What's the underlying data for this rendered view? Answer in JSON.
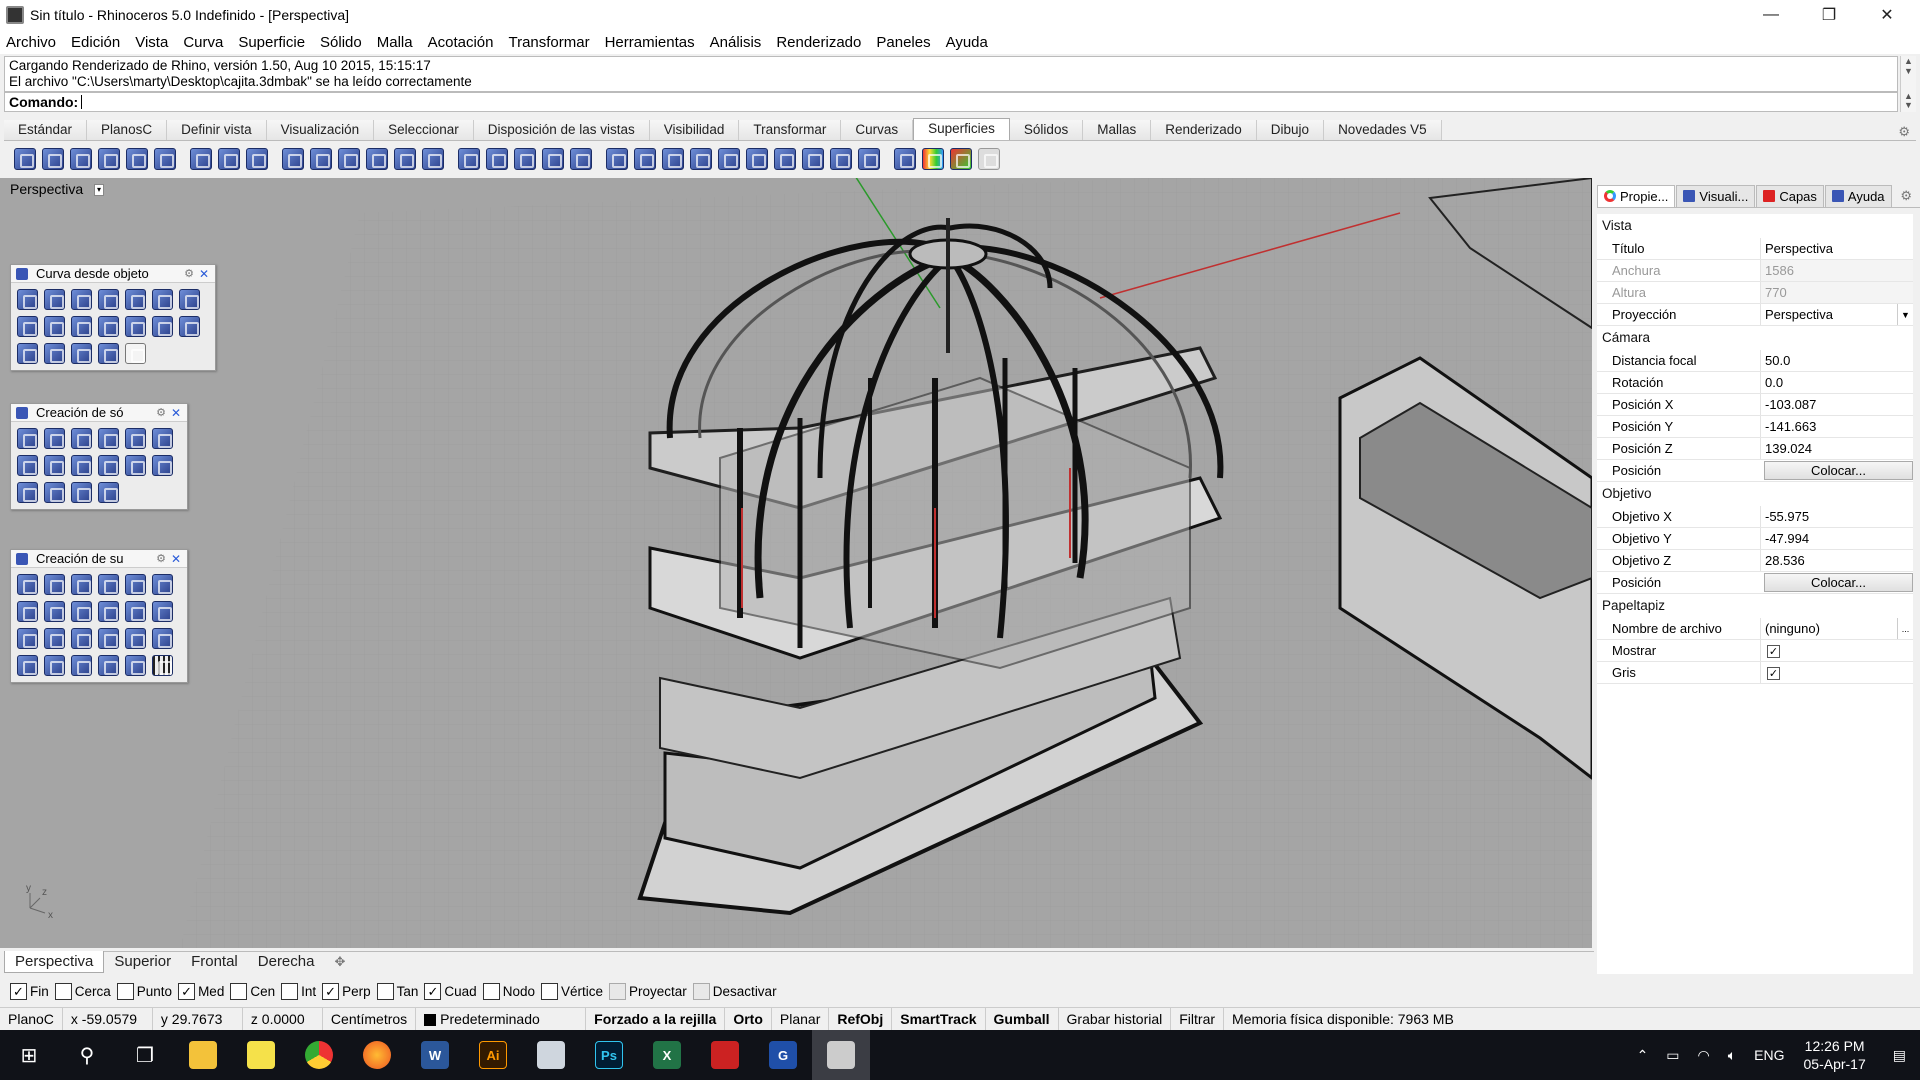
{
  "window": {
    "title": "Sin título - Rhinoceros 5.0 Indefinido - [Perspectiva]",
    "minimize": "—",
    "restore": "❐",
    "close": "✕"
  },
  "menu": [
    "Archivo",
    "Edición",
    "Vista",
    "Curva",
    "Superficie",
    "Sólido",
    "Malla",
    "Acotación",
    "Transformar",
    "Herramientas",
    "Análisis",
    "Renderizado",
    "Paneles",
    "Ayuda"
  ],
  "command_history": {
    "line1": "Cargando Renderizado de Rhino, versión 1.50, Aug 10 2015, 15:15:17",
    "line2": "El archivo \"C:\\Users\\marty\\Desktop\\cajita.3dmbak\" se ha leído correctamente"
  },
  "command_prompt": "Comando:",
  "toolbar_tabs": [
    "Estándar",
    "PlanosC",
    "Definir vista",
    "Visualización",
    "Seleccionar",
    "Disposición de las vistas",
    "Visibilidad",
    "Transformar",
    "Curvas",
    "Superficies",
    "Sólidos",
    "Mallas",
    "Renderizado",
    "Dibujo",
    "Novedades V5"
  ],
  "toolbar_active_tab": "Superficies",
  "viewport": {
    "label": "Perspectiva",
    "axis_label_x": "x",
    "axis_label_y": "y",
    "axis_label_z": "z"
  },
  "palettes": [
    {
      "title": "Curva desde objeto"
    },
    {
      "title": "Creación de só"
    },
    {
      "title": "Creación de su"
    }
  ],
  "panel_tabs": [
    "Propie...",
    "Visuali...",
    "Capas",
    "Ayuda"
  ],
  "properties": {
    "vista_header": "Vista",
    "titulo": {
      "label": "Título",
      "value": "Perspectiva"
    },
    "anchura": {
      "label": "Anchura",
      "value": "1586"
    },
    "altura": {
      "label": "Altura",
      "value": "770"
    },
    "proyeccion": {
      "label": "Proyección",
      "value": "Perspectiva"
    },
    "camara_header": "Cámara",
    "distancia_focal": {
      "label": "Distancia focal",
      "value": "50.0"
    },
    "rotacion": {
      "label": "Rotación",
      "value": "0.0"
    },
    "pos_x": {
      "label": "Posición X",
      "value": "-103.087"
    },
    "pos_y": {
      "label": "Posición Y",
      "value": "-141.663"
    },
    "pos_z": {
      "label": "Posición Z",
      "value": "139.024"
    },
    "posicion_cam": {
      "label": "Posición",
      "button": "Colocar..."
    },
    "objetivo_header": "Objetivo",
    "obj_x": {
      "label": "Objetivo X",
      "value": "-55.975"
    },
    "obj_y": {
      "label": "Objetivo Y",
      "value": "-47.994"
    },
    "obj_z": {
      "label": "Objetivo Z",
      "value": "28.536"
    },
    "posicion_obj": {
      "label": "Posición",
      "button": "Colocar..."
    },
    "papeltapiz_header": "Papeltapiz",
    "nombre_archivo": {
      "label": "Nombre de archivo",
      "value": "(ninguno)",
      "button": "..."
    },
    "mostrar": {
      "label": "Mostrar",
      "checked": true
    },
    "gris": {
      "label": "Gris",
      "checked": true
    }
  },
  "view_tabs": [
    "Perspectiva",
    "Superior",
    "Frontal",
    "Derecha"
  ],
  "view_tab_add": "✥",
  "osnaps": [
    {
      "label": "Fin",
      "checked": true
    },
    {
      "label": "Cerca",
      "checked": false
    },
    {
      "label": "Punto",
      "checked": false
    },
    {
      "label": "Med",
      "checked": true
    },
    {
      "label": "Cen",
      "checked": false
    },
    {
      "label": "Int",
      "checked": false
    },
    {
      "label": "Perp",
      "checked": true
    },
    {
      "label": "Tan",
      "checked": false
    },
    {
      "label": "Cuad",
      "checked": true
    },
    {
      "label": "Nodo",
      "checked": false
    },
    {
      "label": "Vértice",
      "checked": false
    },
    {
      "label": "Proyectar",
      "checked": false,
      "disabled": true
    },
    {
      "label": "Desactivar",
      "checked": false,
      "disabled": true
    }
  ],
  "status": {
    "plane": "PlanoC",
    "x": "x -59.0579",
    "y": "y 29.7673",
    "z": "z 0.0000",
    "units": "Centímetros",
    "layer": "Predeterminado",
    "grid_snap": "Forzado a la rejilla",
    "ortho": "Orto",
    "planar": "Planar",
    "osnap": "RefObj",
    "smarttrack": "SmartTrack",
    "gumball": "Gumball",
    "history": "Grabar historial",
    "filter": "Filtrar",
    "memory": "Memoria física disponible: 7963 MB"
  },
  "taskbar": {
    "apps": [
      "Ai",
      "Ps",
      "X",
      "G"
    ],
    "lang": "ENG",
    "time": "12:26 PM",
    "date": "05-Apr-17"
  },
  "colors": {
    "viewport_bg": "#a5a5a5",
    "grid": "#9a9a9a",
    "x_axis": "#c03030",
    "y_axis": "#2a9a2a",
    "taskbar": "#101218"
  }
}
